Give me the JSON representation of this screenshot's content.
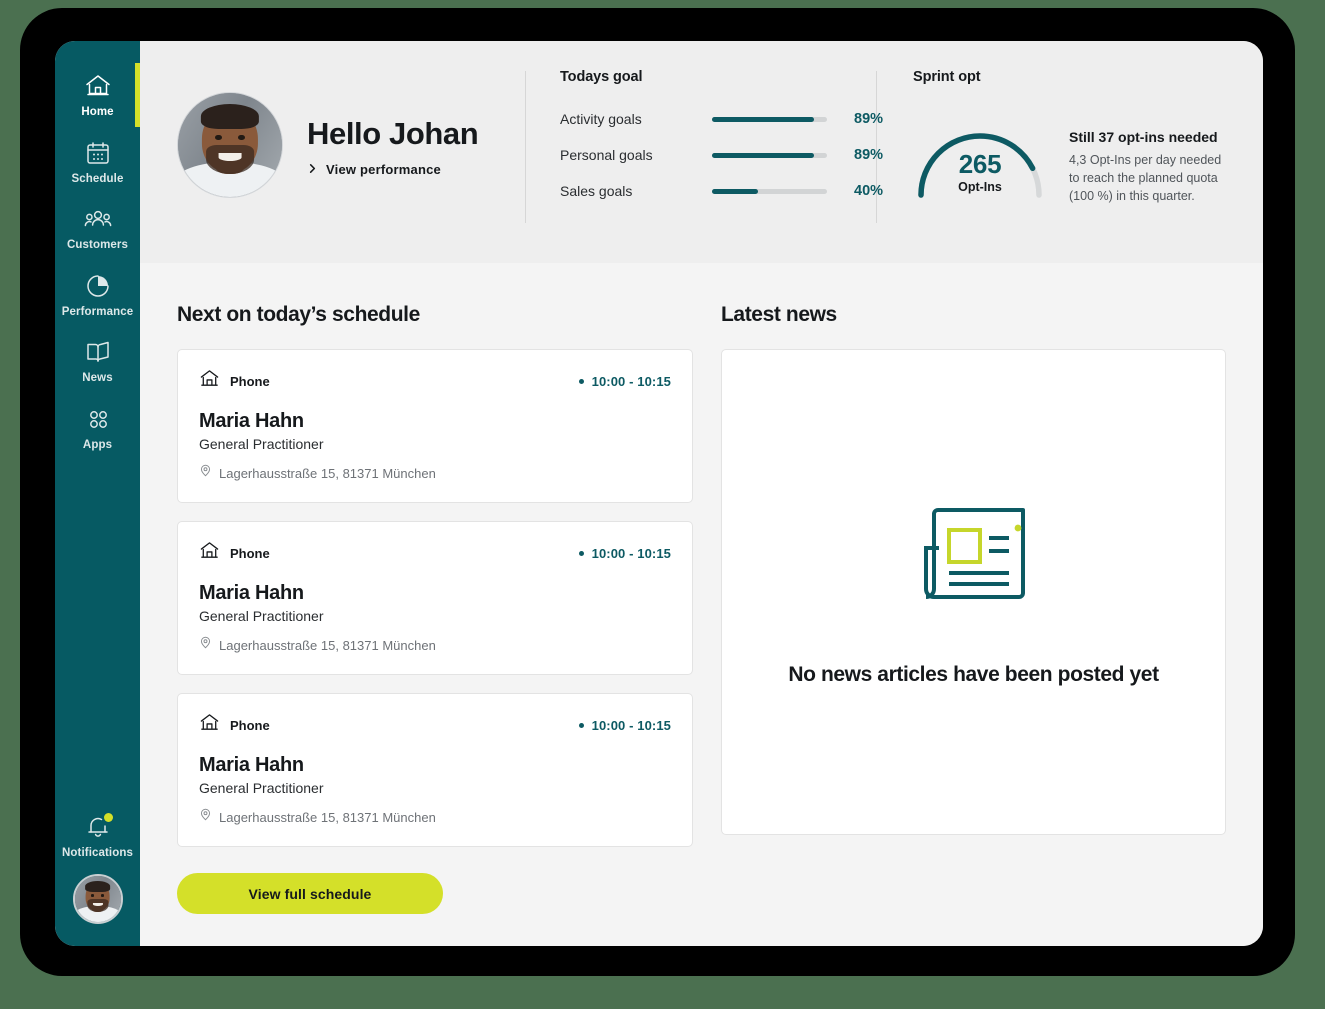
{
  "sidebar": {
    "items": [
      {
        "label": "Home",
        "icon": "home-icon",
        "active": true
      },
      {
        "label": "Schedule",
        "icon": "calendar-icon",
        "active": false
      },
      {
        "label": "Customers",
        "icon": "people-icon",
        "active": false
      },
      {
        "label": "Performance",
        "icon": "pie-chart-icon",
        "active": false
      },
      {
        "label": "News",
        "icon": "book-icon",
        "active": false
      },
      {
        "label": "Apps",
        "icon": "grid-dots-icon",
        "active": false
      }
    ],
    "notifications": {
      "label": "Notifications",
      "icon": "bell-icon",
      "has_badge": true
    },
    "avatar": {
      "name": "user-avatar"
    }
  },
  "header": {
    "greeting": {
      "title": "Hello Johan",
      "link_label": "View performance",
      "link_icon": "chevron-right-icon"
    },
    "goals": {
      "heading": "Todays goal",
      "rows": [
        {
          "label": "Activity goals",
          "percent_label": "89%",
          "percent": 89
        },
        {
          "label": "Personal goals",
          "percent_label": "89%",
          "percent": 89
        },
        {
          "label": "Sales goals",
          "percent_label": "40%",
          "percent": 40
        }
      ]
    },
    "sprint": {
      "heading": "Sprint opt",
      "gauge_value": "265",
      "gauge_unit": "Opt-Ins",
      "gauge_percent": 85,
      "headline": "Still 37 opt-ins needed",
      "description": "4,3 Opt-Ins per day needed to reach the planned quota (100 %) in this quarter."
    }
  },
  "schedule": {
    "title": "Next on today’s schedule",
    "cards": [
      {
        "type_icon": "house-icon",
        "type_label": "Phone",
        "time_label": "10:00 - 10:15",
        "name": "Maria Hahn",
        "role": "General Practitioner",
        "address_icon": "location-pin-icon",
        "address": "Lagerhausstraße 15, 81371 München"
      },
      {
        "type_icon": "house-icon",
        "type_label": "Phone",
        "time_label": "10:00 - 10:15",
        "name": "Maria Hahn",
        "role": "General Practitioner",
        "address_icon": "location-pin-icon",
        "address": "Lagerhausstraße 15, 81371 München"
      },
      {
        "type_icon": "house-icon",
        "type_label": "Phone",
        "time_label": "10:00 - 10:15",
        "name": "Maria Hahn",
        "role": "General Practitioner",
        "address_icon": "location-pin-icon",
        "address": "Lagerhausstraße 15, 81371 München"
      }
    ],
    "button_label": "View full schedule"
  },
  "news": {
    "title": "Latest news",
    "empty_icon": "newspaper-icon",
    "empty_text": "No news articles have been posted yet"
  },
  "colors": {
    "sidebar_teal": "#065a63",
    "accent_teal": "#0d5a63",
    "accent_lime": "#d4e029",
    "header_band": "#eeeeee",
    "content_bg": "#f4f4f4",
    "page_bg": "#4b7050",
    "track_gray": "#d2d4d5"
  }
}
